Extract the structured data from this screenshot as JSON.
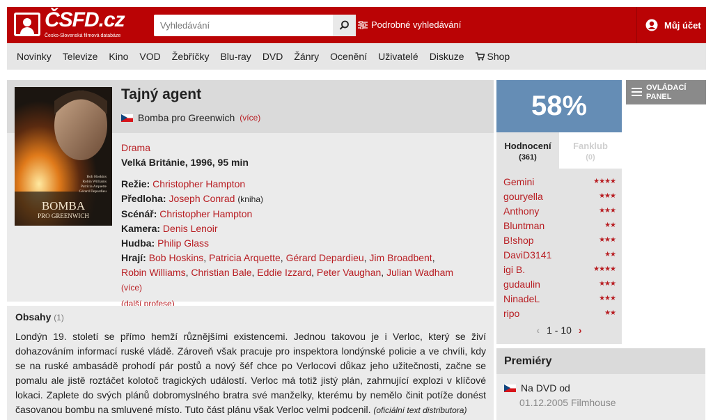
{
  "header": {
    "logo_text": "ČSFD.cz",
    "logo_sub": "Česko-Slovenská filmová databáze",
    "search_placeholder": "Vyhledávání",
    "advanced_search": "Podrobné vyhledávání",
    "account": "Můj účet"
  },
  "nav": [
    "Novinky",
    "Televize",
    "Kino",
    "VOD",
    "Žebříčky",
    "Blu-ray",
    "DVD",
    "Žánry",
    "Ocenění",
    "Uživatelé",
    "Diskuze",
    "Shop"
  ],
  "film": {
    "title": "Tajný agent",
    "alt_title": "Bomba pro Greenwich",
    "more": "(více)",
    "genre": "Drama",
    "origin": "Velká Británie, 1996, 95 min",
    "director_label": "Režie:",
    "director": "Christopher Hampton",
    "source_label": "Předloha:",
    "source": "Joseph Conrad",
    "source_note": "(kniha)",
    "writer_label": "Scénář:",
    "writer": "Christopher Hampton",
    "camera_label": "Kamera:",
    "camera": "Denis Lenoir",
    "music_label": "Hudba:",
    "music": "Philip Glass",
    "cast_label": "Hrají:",
    "cast": [
      "Bob Hoskins",
      "Patricia Arquette",
      "Gérard Depardieu",
      "Jim Broadbent",
      "Robin Williams",
      "Christian Bale",
      "Eddie Izzard",
      "Peter Vaughan",
      "Julian Wadham"
    ],
    "cast_more": "(více)",
    "more_professions": "(další profese)",
    "poster_title": "BOMBA",
    "poster_subtitle": "PRO GREENWICH",
    "poster_credits": [
      "Bob Hoskins",
      "Robin Williams",
      "Patricia Arquette",
      "Gérard Depardieu"
    ]
  },
  "plot": {
    "title": "Obsahy",
    "count": "(1)",
    "text": "Londýn 19. století se přímo hemží různějšími existencemi. Jednou takovou je i Verloc, který se živí dohazováním informací ruské vládě. Zároveň však pracuje pro inspektora londýnské policie a ve chvíli, kdy se na ruské ambasádě prohodí pár postů a nový šéf chce po Verlocovi důkaz jeho užitečnosti, začne se pomalu ale jistě roztáčet kolotoč tragických událostí. Verloc má totiž jistý plán, zahrnující explozi v klíčové lokaci. Zaplete do svých plánů dobromyslného bratra své manželky, kterému by nemělo činit potíže donést časovanou bombu na smluvené místo. Tuto část plánu však Verloc velmi podcenil.",
    "source": "(oficiální text distributora)"
  },
  "rating": {
    "percent": "58%",
    "tab_ratings": "Hodnocení",
    "tab_ratings_count": "(361)",
    "tab_fanclub": "Fanklub",
    "tab_fanclub_count": "(0)",
    "users": [
      {
        "name": "Gemini",
        "stars": 4
      },
      {
        "name": "gouryella",
        "stars": 3
      },
      {
        "name": "Anthony",
        "stars": 3
      },
      {
        "name": "Bluntman",
        "stars": 2
      },
      {
        "name": "B!shop",
        "stars": 3
      },
      {
        "name": "DaviD3141",
        "stars": 2
      },
      {
        "name": "igi B.",
        "stars": 4
      },
      {
        "name": "gudaulin",
        "stars": 3
      },
      {
        "name": "NinadeL",
        "stars": 3
      },
      {
        "name": "ripo",
        "stars": 2
      }
    ],
    "pager": "1 - 10"
  },
  "premieres": {
    "title": "Premiéry",
    "item_label": "Na DVD od",
    "item_detail": "01.12.2005 Filmhouse"
  },
  "panel_button": "OVLÁDACÍ PANEL",
  "colors": {
    "brand": "#ba0305",
    "link": "#b81d22",
    "rating": "#658db5"
  }
}
